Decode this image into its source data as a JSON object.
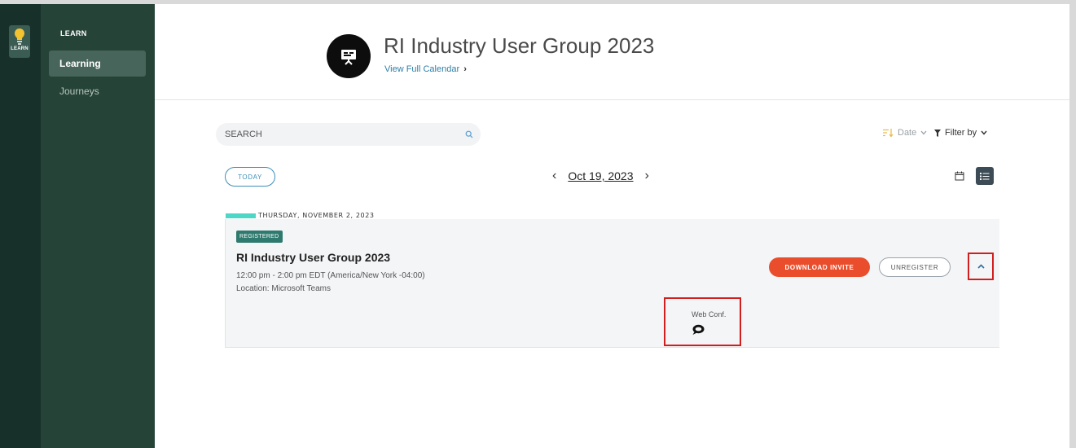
{
  "rail": {
    "app_label": "LEARN"
  },
  "sidebar": {
    "heading": "LEARN",
    "items": [
      {
        "label": "Learning",
        "active": true
      },
      {
        "label": "Journeys",
        "active": false
      }
    ]
  },
  "header": {
    "title": "RI Industry User Group 2023",
    "link": "View Full Calendar"
  },
  "toolbar": {
    "search_placeholder": "SEARCH",
    "sort_label": "Date",
    "filter_label": "Filter by",
    "today_label": "TODAY",
    "current_date": "Oct 19, 2023"
  },
  "day": {
    "label": "THURSDAY, NOVEMBER 2, 2023"
  },
  "event": {
    "badge": "REGISTERED",
    "title": "RI Industry User Group 2023",
    "time": "12:00 pm - 2:00 pm EDT (America/New York -04:00)",
    "location": "Location: Microsoft Teams",
    "download_label": "DOWNLOAD INVITE",
    "unregister_label": "UNREGISTER",
    "web_conf_label": "Web Conf."
  },
  "colors": {
    "accent_blue": "#3d8fb8",
    "download_red": "#ea4d2c",
    "badge_green": "#2f7a6e",
    "day_bar_teal": "#4ed7c6",
    "highlight_red": "#d11f1f",
    "sidebar_bg": "#264338",
    "rail_bg": "#18302a"
  },
  "icons": {
    "rail_app": "lightbulb-icon",
    "header": "presentation-icon",
    "search": "search-icon",
    "sort": "sort-icon",
    "filter": "filter-icon",
    "calendar_view": "calendar-icon",
    "list_view": "list-icon",
    "collapse": "chevron-up-icon",
    "web_conf": "chat-bubble-icon"
  }
}
